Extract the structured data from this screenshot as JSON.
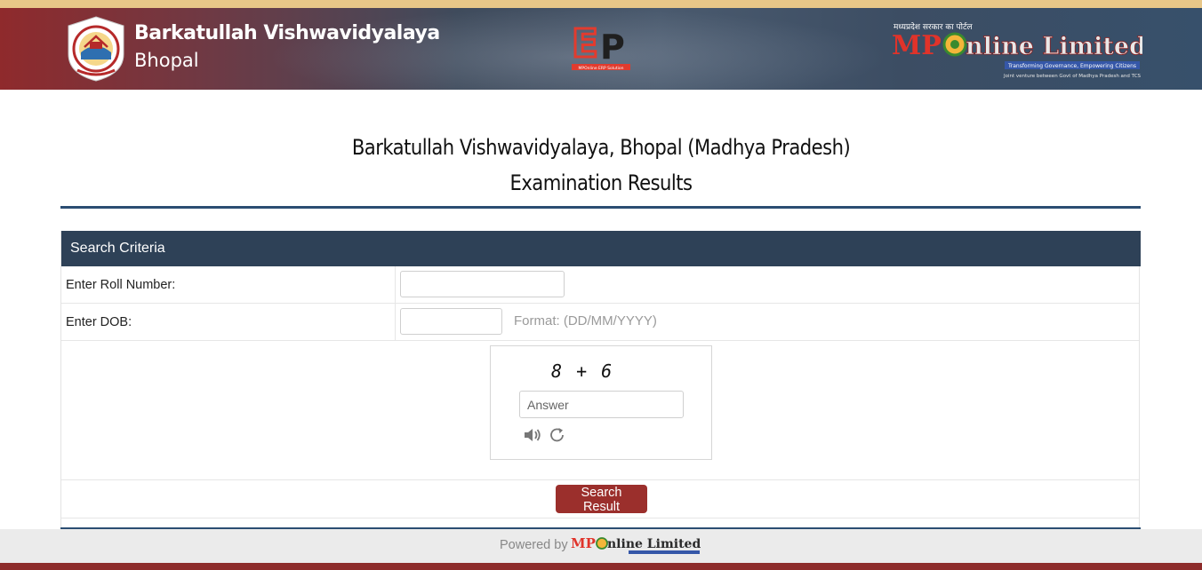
{
  "header": {
    "university_line1": "Barkatullah Vishwavidyalaya",
    "university_line2": "Bhopal",
    "erp_tagline": "MPOnline ERP Solution",
    "mponline_hindi": "मध्यप्रदेश सरकार का पोर्टल",
    "mponline_mp": "MP",
    "mponline_rest": "nline Limited",
    "mponline_tagline": "Transforming Governance, Empowering Citizens",
    "mponline_jv": "Joint venture between Govt of Madhya Pradesh and TCS"
  },
  "page": {
    "title_line1": "Barkatullah Vishwavidyalaya, Bhopal (Madhya Pradesh)",
    "title_line2": "Examination Results"
  },
  "search": {
    "heading": "Search Criteria",
    "roll_label": "Enter Roll Number:",
    "roll_value": "",
    "dob_label": "Enter DOB:",
    "dob_value": "",
    "dob_hint": "Format: (DD/MM/YYYY)",
    "captcha_question": "8 + 6",
    "captcha_placeholder": "Answer",
    "submit_label": "Search Result"
  },
  "footer": {
    "powered_by": "Powered by",
    "logo_mp": "MP",
    "logo_rest": "nline Limited"
  },
  "colors": {
    "panel_header": "#2e4157",
    "button": "#9b2f2c",
    "rule": "#2b4d72",
    "footer_bar": "#8d2c2b"
  },
  "icons": [
    "university-emblem-icon",
    "erp-logo-icon",
    "mponline-logo-icon",
    "speaker-icon",
    "refresh-icon"
  ]
}
